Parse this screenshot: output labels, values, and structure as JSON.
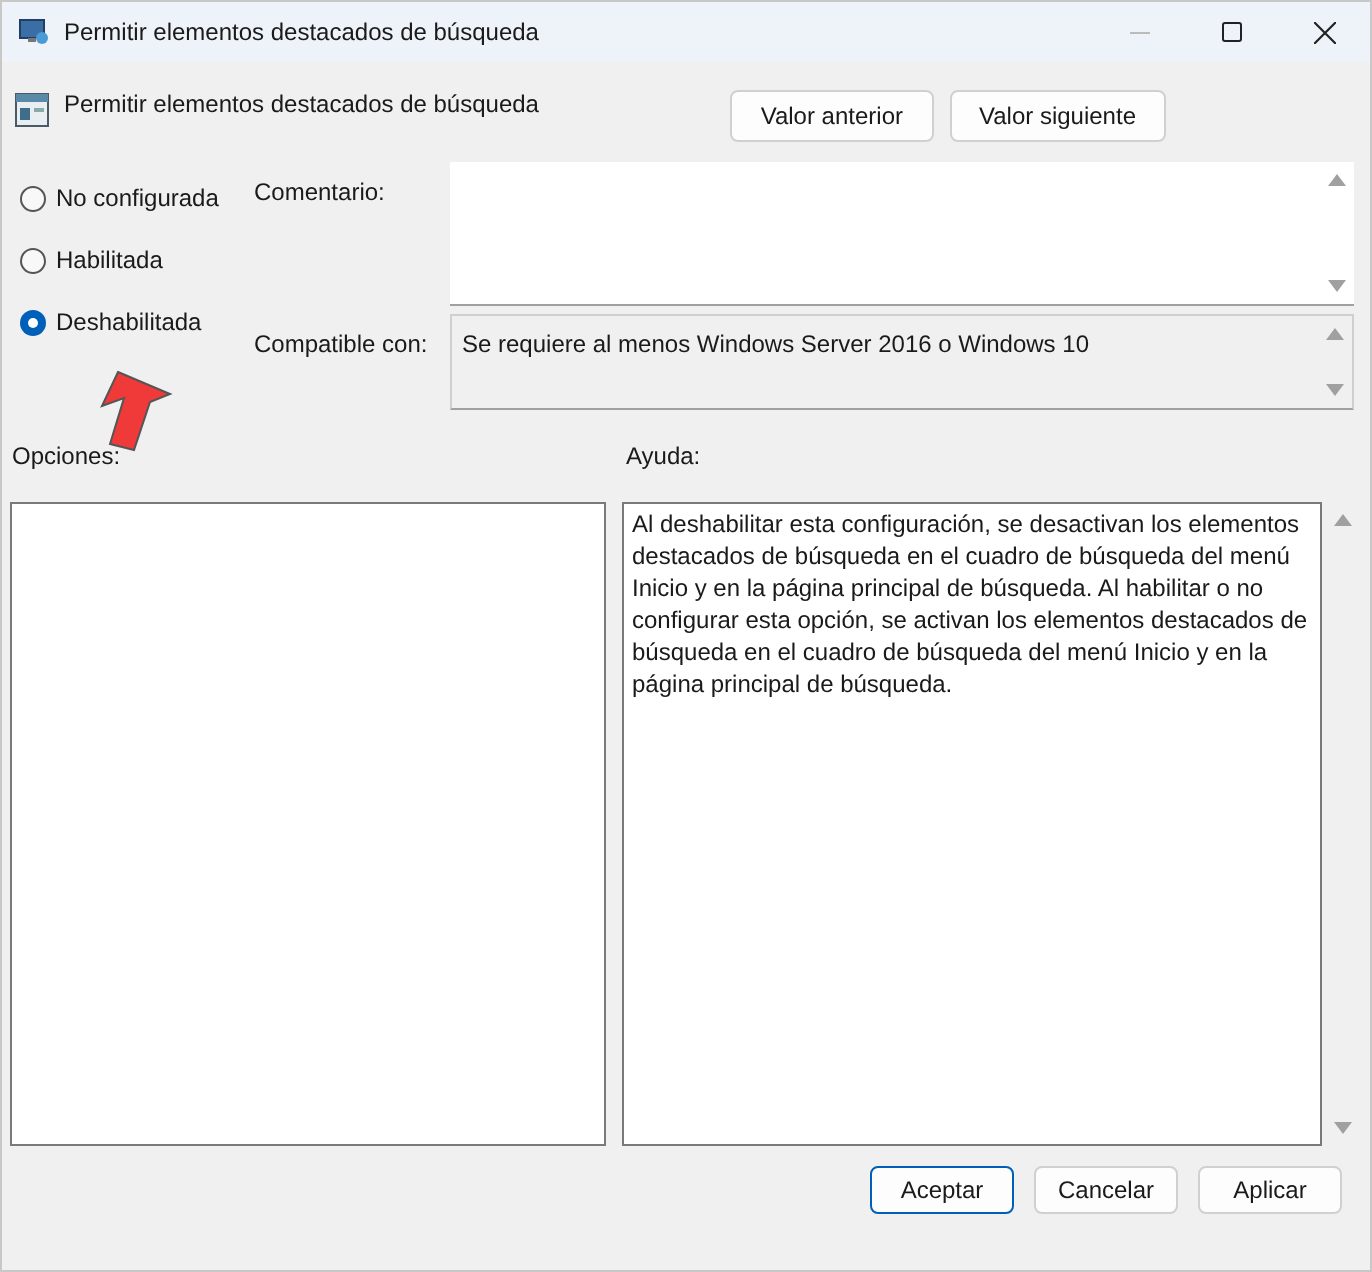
{
  "window": {
    "title": "Permitir elementos destacados de búsqueda"
  },
  "header": {
    "title": "Permitir elementos destacados de búsqueda"
  },
  "nav_buttons": [
    "Valor anterior",
    "Valor siguiente"
  ],
  "options": [
    {
      "label": "No configurada",
      "selected": false
    },
    {
      "label": "Habilitada",
      "selected": false
    },
    {
      "label": "Deshabilitada",
      "selected": true
    }
  ],
  "comment": {
    "label": "Comentario:"
  },
  "compatible": {
    "label": "Compatible con:",
    "value": "Se requiere al menos Windows Server 2016 o Windows 10"
  },
  "options_label": "Opciones:",
  "help": {
    "label": "Ayuda:",
    "text": "Al deshabilitar esta configuración, se desactivan los elementos destacados de búsqueda en el cuadro de búsqueda del menú Inicio y en la página principal de búsqueda. Al habilitar o no configurar esta opción, se activan los elementos destacados de búsqueda en el cuadro de búsqueda del menú Inicio y en la página principal de búsqueda."
  },
  "footer_buttons": [
    {
      "label": "Aceptar",
      "default": true
    },
    {
      "label": "Cancelar",
      "default": false
    },
    {
      "label": "Aplicar",
      "default": false
    }
  ]
}
